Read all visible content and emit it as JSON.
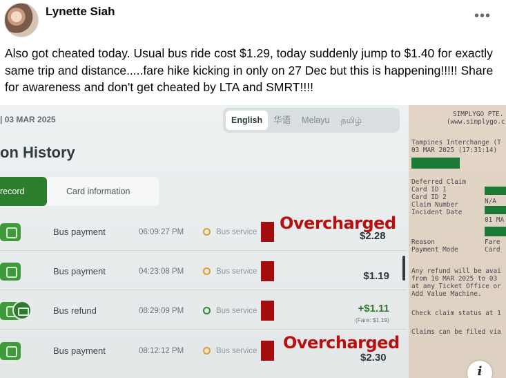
{
  "post": {
    "author": "Lynette Siah",
    "more_label": "•••",
    "text": "Also got cheated today. Usual bus ride cost $1.29, today suddenly jump to $1.40 for exactly same trip and distance.....fare hike kicking in only on 27 Dec but this is happening!!!!! Share for awareness and don't get cheated by LTA and SMRT!!!!"
  },
  "screen": {
    "date": "| 03 MAR 2025",
    "languages": [
      "English",
      "华语",
      "Melayu",
      "தமிழ்"
    ],
    "title": "on History",
    "tabs": {
      "record": "record",
      "card_info": "Card information"
    },
    "rows": [
      {
        "type": "Bus payment",
        "time": "06:09:27 PM",
        "service": "Bus service",
        "amount": "$2.28",
        "overlay": "Overcharged"
      },
      {
        "type": "Bus payment",
        "time": "04:23:08 PM",
        "service": "Bus service",
        "amount": "$1.19"
      },
      {
        "type": "Bus refund",
        "time": "08:29:09 PM",
        "service": "Bus service",
        "amount": "+$1.11",
        "fare_note": "(Fare: $1.19)"
      },
      {
        "type": "Bus payment",
        "time": "08:12:12 PM",
        "service": "Bus service",
        "amount": "$2.30",
        "overlay": "Overcharged"
      }
    ]
  },
  "receipt": {
    "lines": [
      "SIMPLYGO PTE.",
      "(www.simplygo.c",
      "Tampines Interchange (T",
      "03 MAR 2025 (17:31:14)",
      "Deferred Claim",
      "Card ID 1",
      "Card ID 2",
      "Claim Number",
      "Incident Date",
      "Reason",
      "Payment Mode",
      "Any refund will be avai",
      "from 10 MAR 2025 to 03",
      "at any Ticket Office or",
      "Add Value Machine.",
      "Check claim status at 1",
      "Claims can be filed via"
    ],
    "values": {
      "card2": "N/A",
      "incident": "01 MA",
      "reason": "Fare",
      "payment": "Card"
    }
  },
  "info_label": "i",
  "colors": {
    "overcharged": "#b80f0f",
    "accent_green": "#2d7d2f",
    "redaction": "#a30d0d"
  }
}
